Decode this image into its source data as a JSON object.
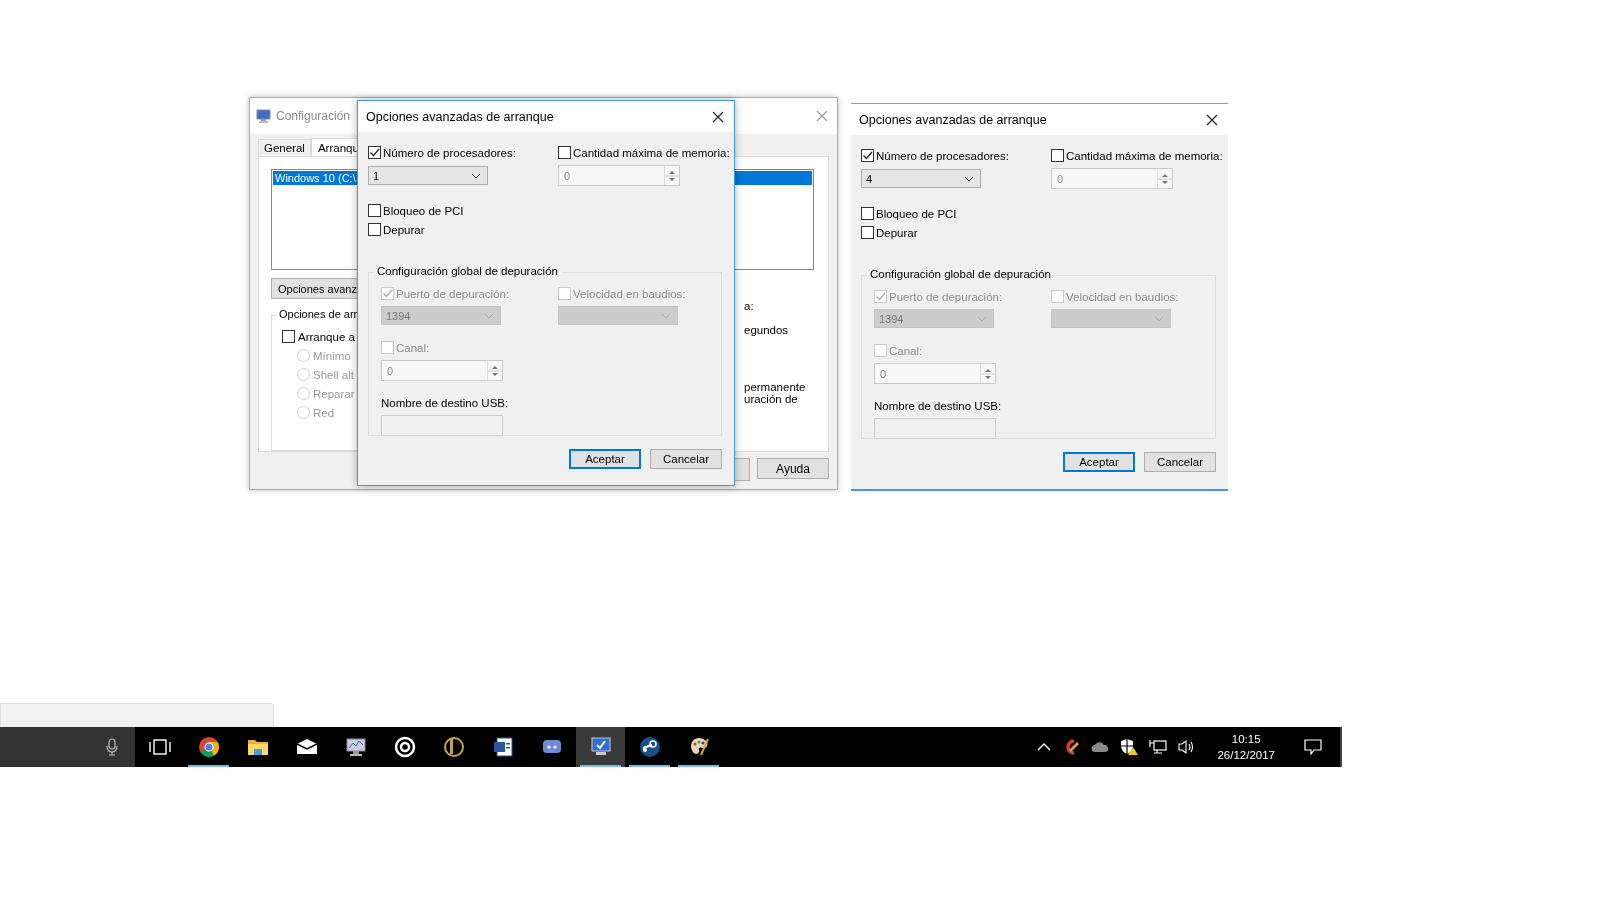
{
  "config_window": {
    "title": "Configuración",
    "tabs": [
      {
        "label": "General",
        "selected": false
      },
      {
        "label": "Arranqu",
        "selected": true
      }
    ],
    "boot_list": [
      {
        "label": "Windows 10 (C:\\",
        "selected": true
      }
    ],
    "advanced_button": "Opciones avanz",
    "boot_options": {
      "legend": "Opciones de arr",
      "safe_boot": {
        "label": "Arranque a",
        "checked": false
      },
      "radios": [
        {
          "label": "Mínimo",
          "selected": false,
          "disabled": true
        },
        {
          "label": "Shell alt",
          "selected": false,
          "disabled": true
        },
        {
          "label": "Reparar",
          "selected": false,
          "disabled": true
        },
        {
          "label": "Red",
          "selected": false,
          "disabled": true
        }
      ]
    },
    "right_texts": [
      "a:",
      "egundos",
      "permanente",
      "uración de"
    ],
    "buttons": [
      "Ayuda"
    ]
  },
  "dialogs": [
    {
      "title": "Opciones avanzadas de arranque",
      "processors": {
        "label": "Número de procesadores:",
        "checked": true,
        "value": "1"
      },
      "max_memory": {
        "label": "Cantidad máxima de memoria:",
        "checked": false,
        "value": "0",
        "disabled": true
      },
      "pci_lock": {
        "label": "Bloqueo de PCI",
        "checked": false
      },
      "debug": {
        "label": "Depurar",
        "checked": false
      },
      "debug_settings": {
        "legend": "Configuración global de depuración",
        "port": {
          "label": "Puerto de depuración:",
          "checked": true,
          "disabled": true,
          "value": "1394"
        },
        "baud": {
          "label": "Velocidad en baudios:",
          "checked": false,
          "disabled": true
        },
        "channel": {
          "label": "Canal:",
          "checked": false,
          "disabled": true,
          "value": "0"
        },
        "usb_target": {
          "label": "Nombre de destino USB:"
        }
      },
      "buttons": [
        {
          "label": "Aceptar",
          "default": true
        },
        {
          "label": "Cancelar",
          "default": false
        }
      ]
    },
    {
      "title": "Opciones avanzadas de arranque",
      "processors": {
        "label": "Número de procesadores:",
        "checked": true,
        "value": "4"
      },
      "max_memory": {
        "label": "Cantidad máxima de memoria:",
        "checked": false,
        "value": "0",
        "disabled": true
      },
      "pci_lock": {
        "label": "Bloqueo de PCI",
        "checked": false
      },
      "debug": {
        "label": "Depurar",
        "checked": false
      },
      "debug_settings": {
        "legend": "Configuración global de depuración",
        "port": {
          "label": "Puerto de depuración:",
          "checked": true,
          "disabled": true,
          "value": "1394"
        },
        "baud": {
          "label": "Velocidad en baudios:",
          "checked": false,
          "disabled": true
        },
        "channel": {
          "label": "Canal:",
          "checked": false,
          "disabled": true,
          "value": "0"
        },
        "usb_target": {
          "label": "Nombre de destino USB:"
        }
      },
      "buttons": [
        {
          "label": "Aceptar",
          "default": true
        },
        {
          "label": "Cancelar",
          "default": false
        }
      ]
    }
  ],
  "taskbar": {
    "apps": [
      {
        "running": true,
        "active": false
      },
      {
        "running": false,
        "active": false
      },
      {
        "running": false,
        "active": false
      },
      {
        "running": false,
        "active": false
      },
      {
        "running": false,
        "active": false
      },
      {
        "running": false,
        "active": false
      },
      {
        "running": false,
        "active": false
      },
      {
        "running": false,
        "active": false
      },
      {
        "running": true,
        "active": true
      },
      {
        "running": true,
        "active": false
      },
      {
        "running": true,
        "active": false
      }
    ],
    "time": "10:15",
    "date": "26/12/2017"
  }
}
